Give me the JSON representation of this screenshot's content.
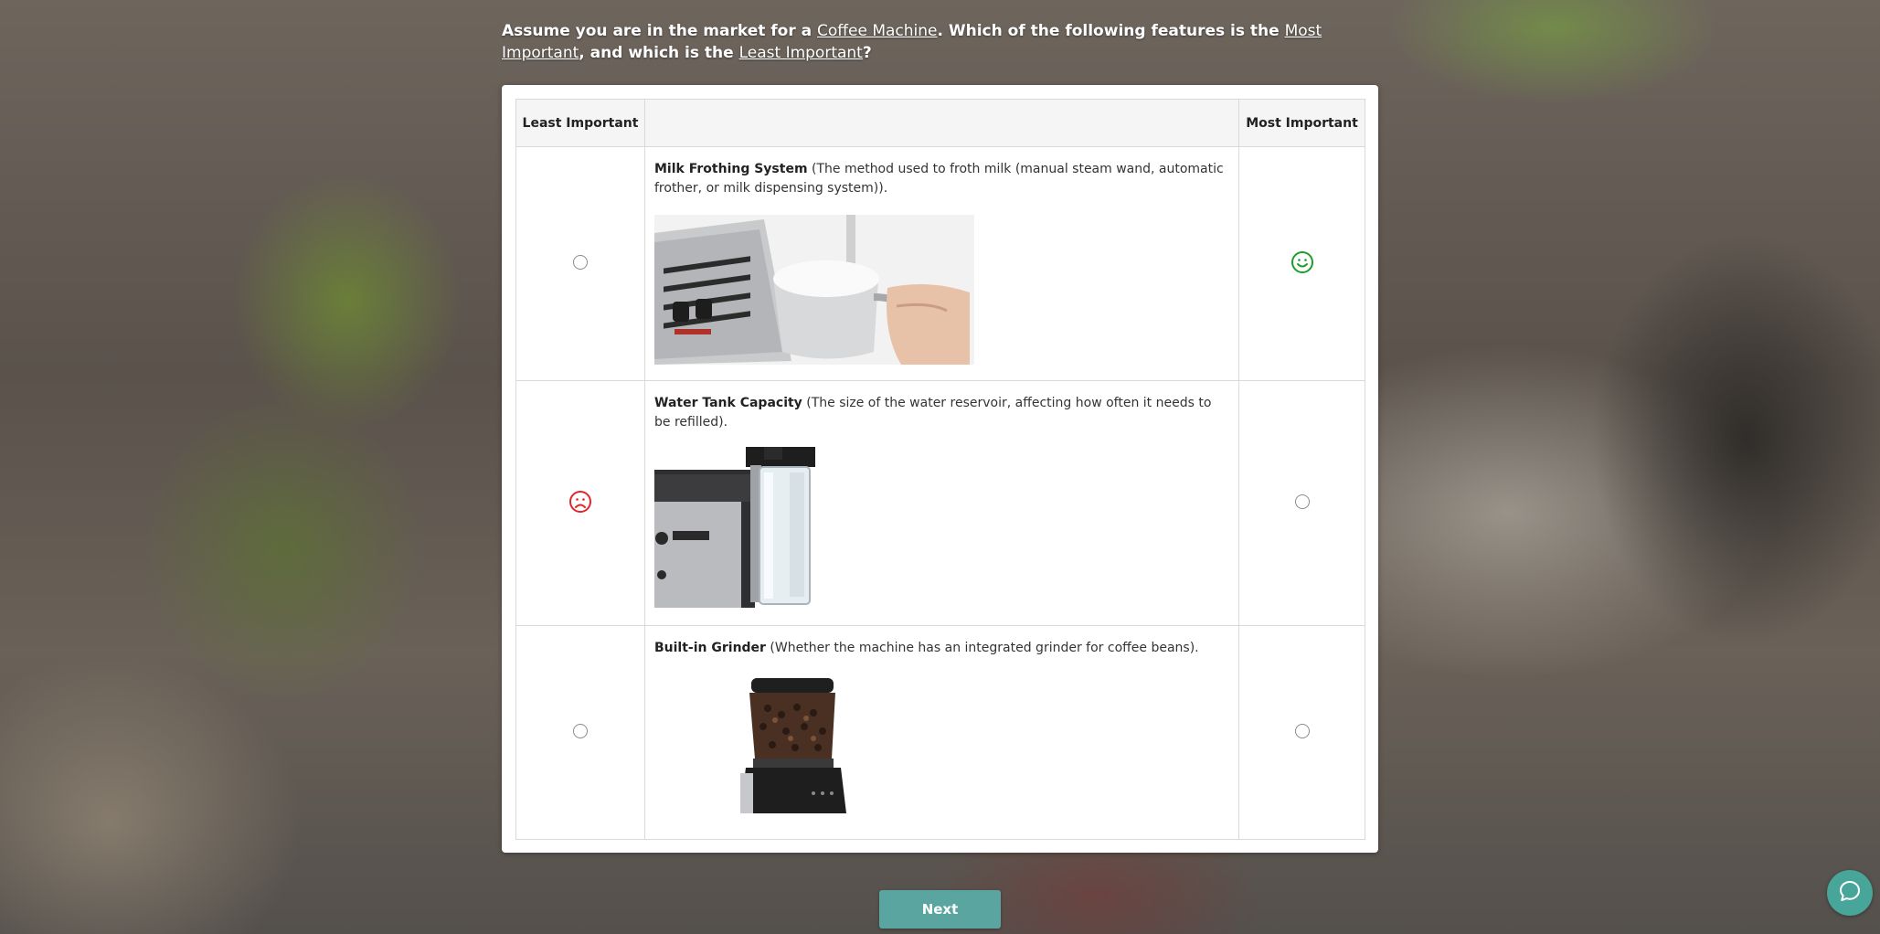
{
  "prompt": {
    "part1": "Assume you are in the market for a ",
    "product": "Coffee Machine",
    "part2": ". Which of the following features is the ",
    "most": "Most Important",
    "part3": ", and which is the ",
    "least": "Least Important",
    "part4": "?"
  },
  "table": {
    "header_left": "Least Important",
    "header_middle": "",
    "header_right": "Most Important",
    "rows": [
      {
        "title": "Milk Frothing System",
        "description": " (The method used to froth milk (manual steam wand, automatic frother, or milk dispensing system)).",
        "least_selected": false,
        "most_selected": true
      },
      {
        "title": "Water Tank Capacity",
        "description": " (The size of the water reservoir, affecting how often it needs to be refilled).",
        "least_selected": true,
        "most_selected": false
      },
      {
        "title": "Built-in Grinder",
        "description": " (Whether the machine has an integrated grinder for coffee beans).",
        "least_selected": false,
        "most_selected": false
      }
    ]
  },
  "colors": {
    "most_selected": "#1f9d2a",
    "least_selected": "#e0262c",
    "next_button": "#5ba5a0",
    "chat_button": "#47a59a"
  },
  "icons": {
    "most_selected": "smiley-face-icon",
    "least_selected": "sad-face-icon",
    "chat": "chat-bubble-icon"
  },
  "next_button": {
    "label": "Next"
  }
}
